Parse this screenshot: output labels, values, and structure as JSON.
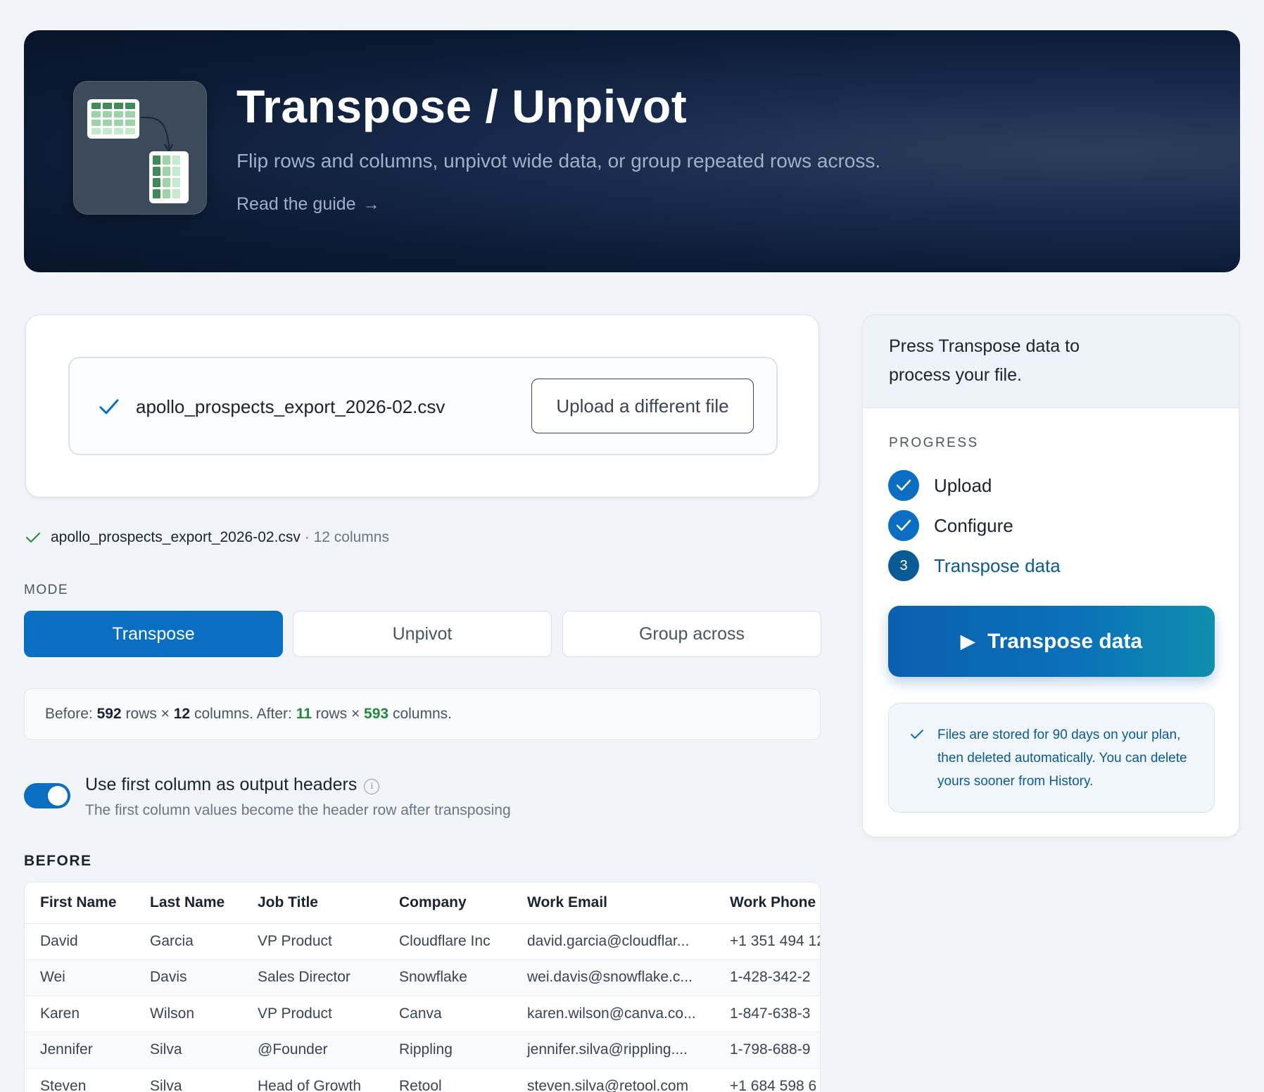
{
  "hero": {
    "title": "Transpose / Unpivot",
    "subtitle": "Flip rows and columns, unpivot wide data, or group repeated rows across.",
    "guide_link": "Read the guide",
    "icon": "transpose-table-icon"
  },
  "upload": {
    "filename": "apollo_prospects_export_2026-02.csv",
    "change_button": "Upload a different file",
    "status_icon": "check-icon"
  },
  "file_info": {
    "filename": "apollo_prospects_export_2026-02.csv",
    "meta": "· 12 columns"
  },
  "mode": {
    "label": "MODE",
    "options": [
      "Transpose",
      "Unpivot",
      "Group across"
    ],
    "selected": "Transpose"
  },
  "stats": {
    "before_label": "Before:",
    "before_rows": "592",
    "rows_word": "rows",
    "times": "×",
    "before_cols": "12",
    "cols_word": "columns.",
    "after_label": "After:",
    "after_rows": "11",
    "after_cols": "593"
  },
  "header_toggle": {
    "label": "Use first column as output headers",
    "description": "The first column values become the header row after transposing",
    "enabled": true,
    "info_icon": "info-icon"
  },
  "before_table": {
    "label": "BEFORE",
    "columns": [
      "First Name",
      "Last Name",
      "Job Title",
      "Company",
      "Work Email",
      "Work Phone"
    ],
    "rows": [
      [
        "David",
        "Garcia",
        "VP Product",
        "Cloudflare Inc",
        "david.garcia@cloudflar...",
        "+1 351 494 12"
      ],
      [
        "Wei",
        "Davis",
        "Sales Director",
        "Snowflake",
        "wei.davis@snowflake.c...",
        "1-428-342-2"
      ],
      [
        "Karen",
        "Wilson",
        "VP Product",
        "Canva",
        "karen.wilson@canva.co...",
        "1-847-638-3"
      ],
      [
        "Jennifer",
        "Silva",
        "@Founder",
        "Rippling",
        "jennifer.silva@rippling....",
        "1-798-688-9"
      ],
      [
        "Steven",
        "Silva",
        "Head of Growth",
        "Retool",
        "steven.silva@retool.com",
        "+1 684 598 6"
      ]
    ]
  },
  "side": {
    "prompt": "Press Transpose data to process your file.",
    "progress_label": "PROGRESS",
    "steps": [
      {
        "label": "Upload",
        "state": "done"
      },
      {
        "label": "Configure",
        "state": "done"
      },
      {
        "label": "Transpose data",
        "state": "current",
        "number": "3"
      }
    ],
    "run_button": "Transpose data",
    "run_icon": "play-icon",
    "notice": "Files are stored for 90 days on your plan, then deleted automatically. You can delete yours sooner from History."
  },
  "colors": {
    "accent": "#0a6fc3",
    "hero_bg": "#0b1a33",
    "success": "#208a3c",
    "notice_text": "#0a5a96"
  }
}
